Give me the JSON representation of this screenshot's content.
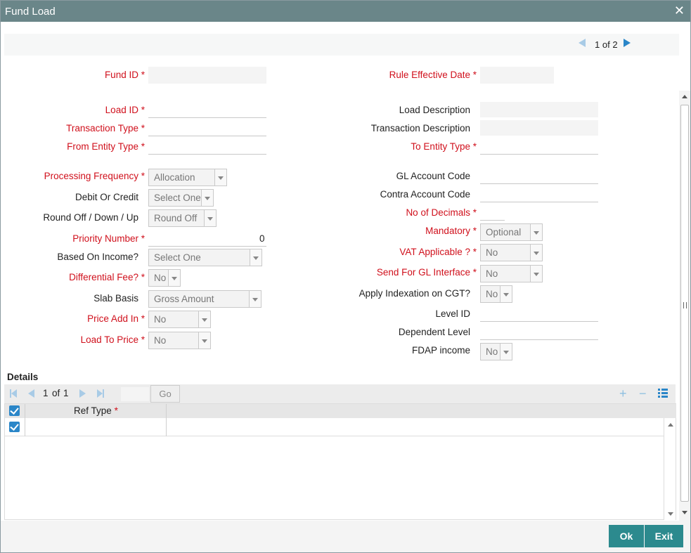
{
  "window": {
    "title": "Fund Load"
  },
  "pager": {
    "current": "1",
    "of": "of",
    "total": "2"
  },
  "fields": {
    "fund_id": {
      "label": "Fund ID"
    },
    "rule_effective_date": {
      "label": "Rule Effective Date"
    },
    "load_id": {
      "label": "Load ID"
    },
    "load_description": {
      "label": "Load Description"
    },
    "transaction_type": {
      "label": "Transaction Type"
    },
    "transaction_description": {
      "label": "Transaction Description"
    },
    "from_entity_type": {
      "label": "From Entity Type"
    },
    "to_entity_type": {
      "label": "To Entity Type"
    },
    "processing_frequency": {
      "label": "Processing Frequency",
      "value": "Allocation"
    },
    "gl_account_code": {
      "label": "GL Account Code"
    },
    "debit_or_credit": {
      "label": "Debit Or Credit",
      "value": "Select One"
    },
    "contra_account_code": {
      "label": "Contra Account Code"
    },
    "round_off": {
      "label": "Round Off / Down / Up",
      "value": "Round Off"
    },
    "no_of_decimals": {
      "label": "No of Decimals"
    },
    "priority_number": {
      "label": "Priority Number",
      "value": "0"
    },
    "mandatory": {
      "label": "Mandatory",
      "value": "Optional"
    },
    "based_on_income": {
      "label": "Based On Income?",
      "value": "Select One"
    },
    "vat_applicable": {
      "label": "VAT Applicable ?",
      "value": "No"
    },
    "differential_fee": {
      "label": "Differential Fee?",
      "value": "No"
    },
    "send_for_gl": {
      "label": "Send For GL Interface",
      "value": "No"
    },
    "slab_basis": {
      "label": "Slab Basis",
      "value": "Gross Amount"
    },
    "apply_indexation": {
      "label": "Apply Indexation on CGT?",
      "value": "No"
    },
    "price_add_in": {
      "label": "Price Add In",
      "value": "No"
    },
    "level_id": {
      "label": "Level ID"
    },
    "load_to_price": {
      "label": "Load To Price",
      "value": "No"
    },
    "dependent_level": {
      "label": "Dependent Level"
    },
    "fdap_income": {
      "label": "FDAP income",
      "value": "No"
    }
  },
  "required_marker": "*",
  "details": {
    "title": "Details",
    "pager": {
      "current": "1",
      "of": "of",
      "total": "1"
    },
    "go_label": "Go",
    "add_label": "+",
    "remove_label": "−",
    "columns": [
      {
        "label": "Ref Type",
        "required": "*"
      }
    ]
  },
  "footer": {
    "ok_label": "Ok",
    "exit_label": "Exit"
  },
  "colors": {
    "titlebar": "#6a8689",
    "required": "#d0101c",
    "button": "#2c8a8e",
    "accent": "#2a86c8"
  },
  "icons": {
    "close": "close-icon",
    "prev": "triangle-left-icon",
    "next": "triangle-right-icon",
    "list": "list-view-icon",
    "checkbox": "checkbox-checked-icon"
  }
}
